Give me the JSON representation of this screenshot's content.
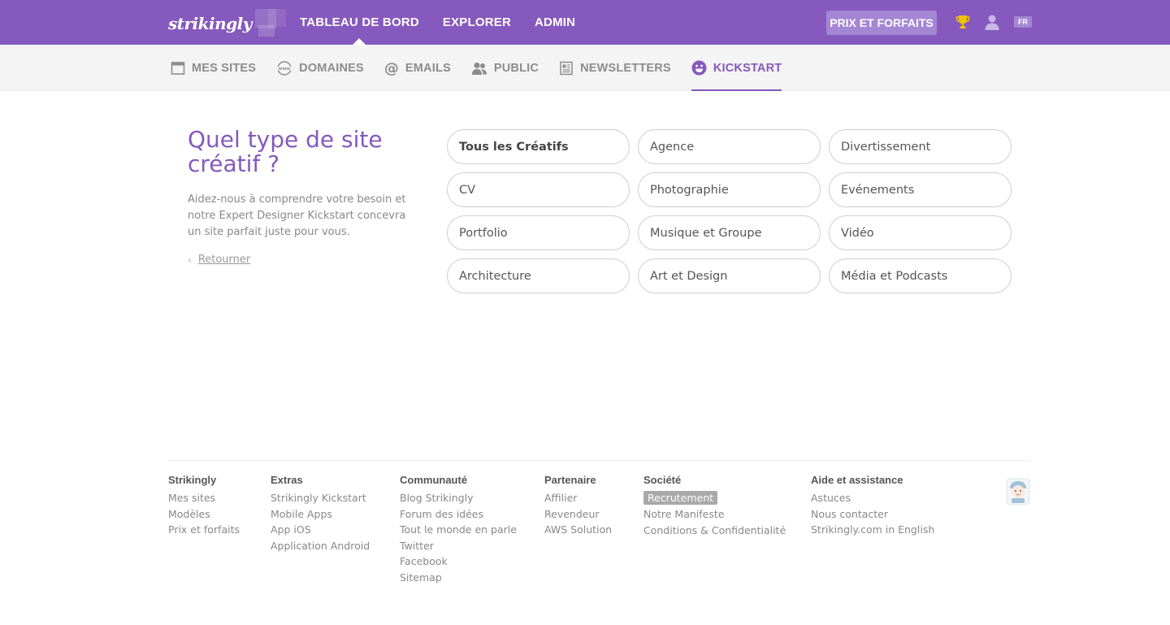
{
  "brand": {
    "logo_text": "strikingly"
  },
  "main_nav": [
    {
      "label": "TABLEAU DE BORD",
      "active": true
    },
    {
      "label": "EXPLORER",
      "active": false
    },
    {
      "label": "ADMIN",
      "active": false
    }
  ],
  "header_actions": {
    "pricing_label": "PRIX ET FORFAITS",
    "trophy_icon": "trophy-icon",
    "user_icon": "user-icon",
    "language": "FR"
  },
  "sub_nav": [
    {
      "label": "MES SITES",
      "icon": "browser-window-icon",
      "active": false
    },
    {
      "label": "DOMAINES",
      "icon": "www-globe-icon",
      "active": false
    },
    {
      "label": "EMAILS",
      "icon": "at-sign-icon",
      "active": false
    },
    {
      "label": "PUBLIC",
      "icon": "people-icon",
      "active": false
    },
    {
      "label": "NEWSLETTERS",
      "icon": "newsletter-icon",
      "active": false
    },
    {
      "label": "KICKSTART",
      "icon": "smiley-icon",
      "active": true
    }
  ],
  "main": {
    "title": "Quel type de site créatif ?",
    "description": "Aidez-nous à comprendre votre besoin et notre Expert Designer Kickstart concevra un site parfait juste pour vous.",
    "back_label": "Retourner",
    "options": [
      "Tous les Créatifs",
      "Agence",
      "Divertissement",
      "CV",
      "Photographie",
      "Evénements",
      "Portfolio",
      "Musique et Groupe",
      "Vidéo",
      "Architecture",
      "Art et Design",
      "Média et Podcasts"
    ],
    "selected_option": "Tous les Créatifs"
  },
  "footer": {
    "columns": [
      {
        "title": "Strikingly",
        "links": [
          "Mes sites",
          "Modèles",
          "Prix et forfaits"
        ]
      },
      {
        "title": "Extras",
        "links": [
          "Strikingly Kickstart",
          "Mobile Apps",
          "App iOS",
          "Application Android"
        ]
      },
      {
        "title": "Communauté",
        "links": [
          "Blog Strikingly",
          "Forum des idées",
          "Tout le monde en parle",
          "Twitter",
          "Facebook",
          "Sitemap"
        ]
      },
      {
        "title": "Partenaire",
        "links": [
          "Affilier",
          "Revendeur",
          "AWS Solution"
        ]
      },
      {
        "title": "Société",
        "links": [
          "Recrutement",
          "Notre Manifeste",
          "Conditions & Confidentialité"
        ],
        "highlighted": "Recrutement"
      },
      {
        "title": "Aide et assistance",
        "links": [
          "Astuces",
          "Nous contacter",
          "Strikingly.com in English"
        ]
      }
    ],
    "mascot_icon": "mascot-icon"
  },
  "colors": {
    "brand_purple": "#8559bd",
    "button_purple": "#a486d4",
    "subnav_bg": "#f4f4f4",
    "trophy_gold": "#f2c200"
  }
}
